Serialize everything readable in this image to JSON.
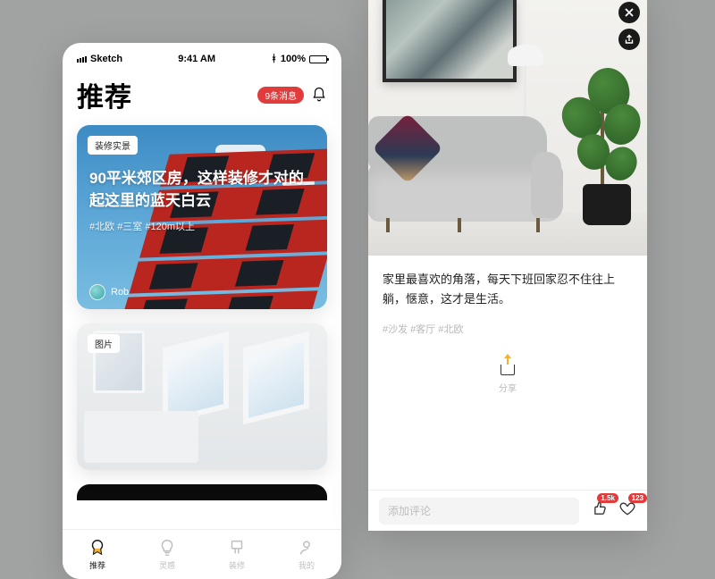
{
  "statusBar": {
    "carrier": "Sketch",
    "time": "9:41 AM",
    "battery": "100%",
    "bluetooth": "✢"
  },
  "left": {
    "title": "推荐",
    "badge": "9条消息",
    "card1": {
      "tag": "装修实景",
      "title": "90平米郊区房，这样装修才对的起这里的蓝天白云",
      "tags": "#北欧 #三室 #120m以上",
      "author": "Rob"
    },
    "card2": {
      "tag": "图片"
    },
    "tabs": [
      {
        "label": "推荐"
      },
      {
        "label": "灵感"
      },
      {
        "label": "装修"
      },
      {
        "label": "我的"
      }
    ]
  },
  "right": {
    "caption": "家里最喜欢的角落，每天下班回家忍不住往上躺，惬意，这才是生活。",
    "tags": "#沙发  #客厅  #北欧",
    "share": "分享",
    "commentPlaceholder": "添加评论",
    "likes": "1.5k",
    "favs": "123"
  }
}
